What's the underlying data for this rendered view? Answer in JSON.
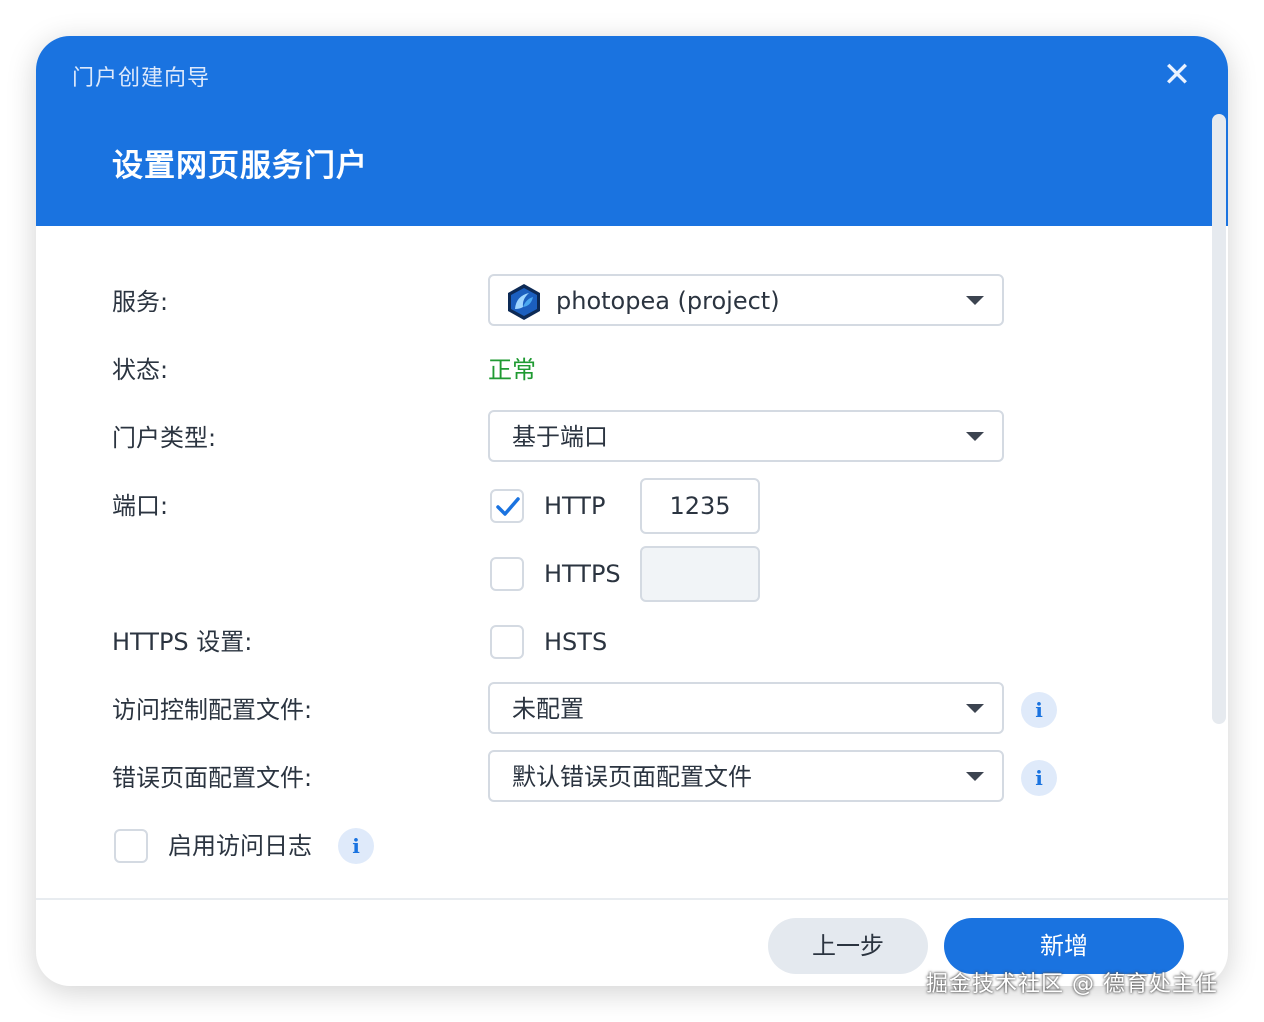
{
  "dialog": {
    "wizard_title": "门户创建向导",
    "close_glyph": "✕",
    "step_title": "设置网页服务门户"
  },
  "form": {
    "service_label": "服务:",
    "service_value": "photopea (project)",
    "service_icon": "photopea-icon",
    "status_label": "状态:",
    "status_value": "正常",
    "status_color": "#1f9a32",
    "portal_type_label": "门户类型:",
    "portal_type_value": "基于端口",
    "port_label": "端口:",
    "http_label": "HTTP",
    "http_checked": true,
    "http_port": "1235",
    "https_label": "HTTPS",
    "https_checked": false,
    "https_port": "",
    "https_settings_label": "HTTPS 设置:",
    "hsts_label": "HSTS",
    "hsts_checked": false,
    "access_profile_label": "访问控制配置文件:",
    "access_profile_value": "未配置",
    "error_page_label": "错误页面配置文件:",
    "error_page_value": "默认错误页面配置文件",
    "enable_log_label": "启用访问日志",
    "enable_log_checked": false,
    "info_glyph": "i"
  },
  "footer": {
    "back_label": "上一步",
    "add_label": "新增"
  },
  "watermark": "掘金技术社区 @ 德育处主任",
  "colors": {
    "accent": "#1a73e0",
    "text": "#2b3440"
  }
}
